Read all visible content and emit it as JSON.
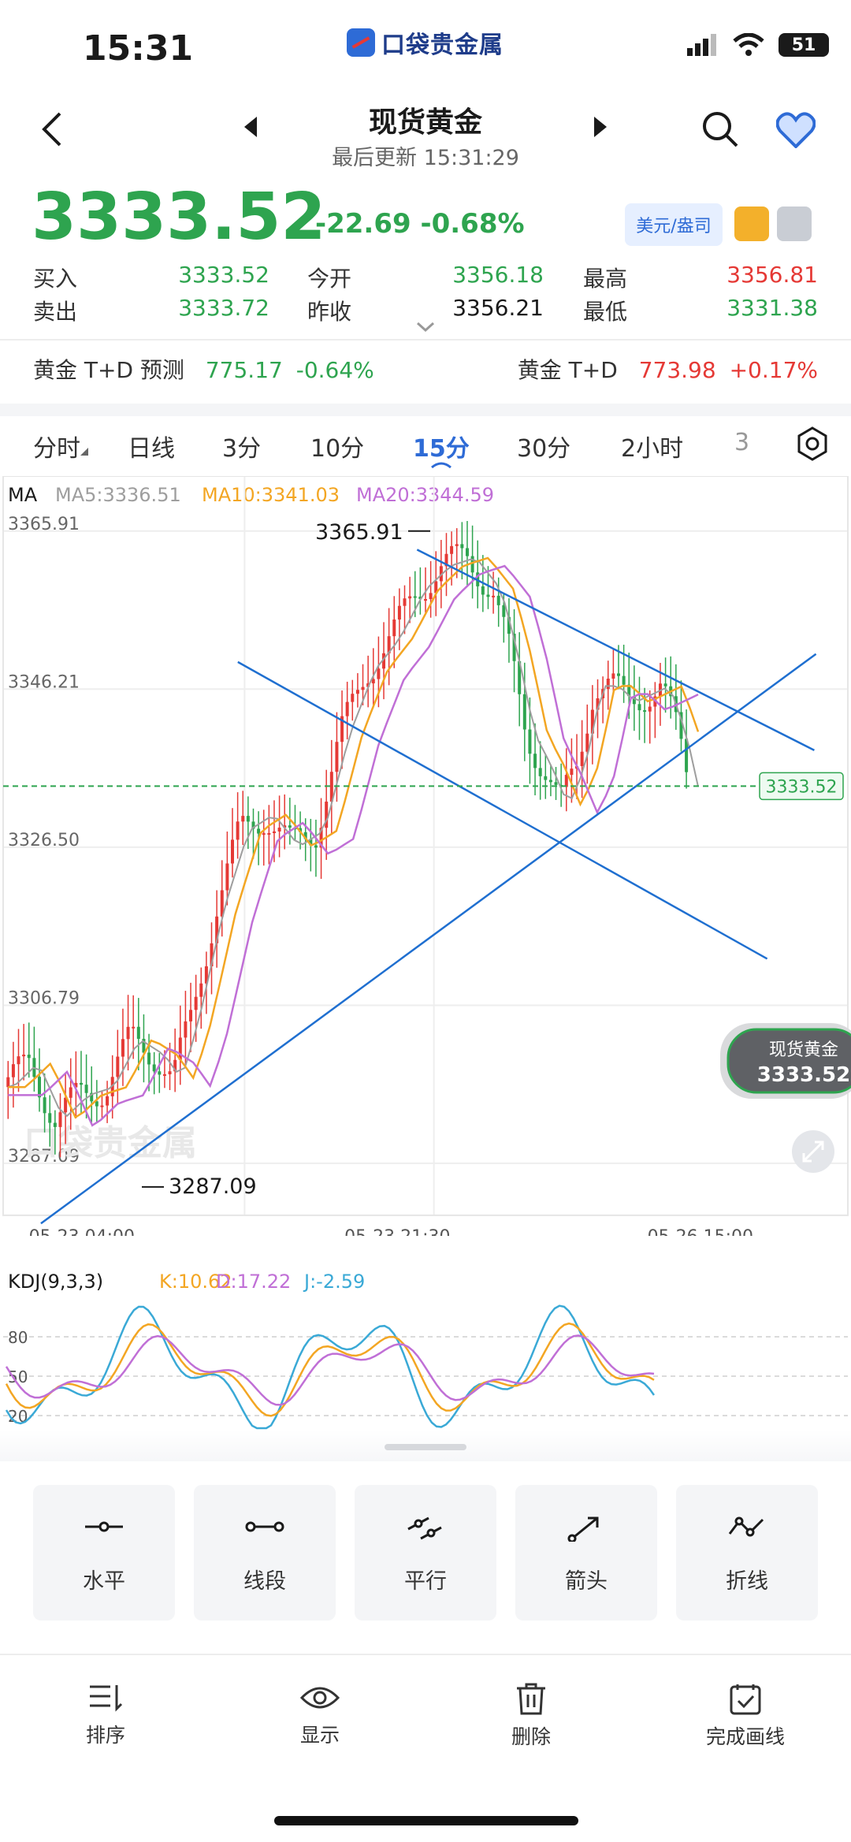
{
  "status": {
    "time": "15:31",
    "battery": "51"
  },
  "app": {
    "logo_text": "口袋贵金属"
  },
  "header": {
    "title": "现货黄金",
    "subtitle": "最后更新 15:31:29"
  },
  "quote": {
    "price": "3333.52",
    "change": "-22.69 -0.68%",
    "currency_button": "美元/盎司",
    "buy_label": "买入",
    "buy_value": "3333.52",
    "sell_label": "卖出",
    "sell_value": "3333.72",
    "open_label": "今开",
    "open_value": "3356.18",
    "prev_close_label": "昨收",
    "prev_close_value": "3356.21",
    "high_label": "最高",
    "high_value": "3356.81",
    "low_label": "最低",
    "low_value": "3331.38"
  },
  "td": {
    "forecast_label": "黄金 T+D 预测",
    "forecast_value": "775.17",
    "forecast_change": "-0.64%",
    "td_label": "黄金 T+D",
    "td_value": "773.98",
    "td_change": "+0.17%"
  },
  "tabs": [
    "分时",
    "日线",
    "3分",
    "10分",
    "15分",
    "30分",
    "2小时",
    "3"
  ],
  "active_tab": "15分",
  "ma": {
    "label": "MA",
    "ma5": "MA5:3336.51",
    "ma10": "MA10:3341.03",
    "ma20": "MA20:3344.59"
  },
  "chart_data": {
    "type": "candlestick",
    "interval": "15分",
    "y_ticks": [
      "3365.91",
      "3346.21",
      "3326.50",
      "3306.79",
      "3287.09"
    ],
    "x_ticks": [
      "05-23 04:00",
      "05-23 21:30",
      "05-26 15:00"
    ],
    "high_annotation": "3365.91",
    "low_annotation": "3287.09",
    "current_price_label": "3333.52",
    "ylim": [
      3281.0,
      3371.0
    ],
    "colors": {
      "up": "#e53935",
      "down": "#2ea44f",
      "ma5": "#9e9e9e",
      "ma10": "#f3a623",
      "ma20": "#c06fd6",
      "drawn_lines": "#1f6fd0"
    },
    "drawn_lines": [
      {
        "from": [
          0.043,
          3279.0
        ],
        "to": [
          0.964,
          3350.0
        ]
      },
      {
        "from": [
          0.277,
          3349.0
        ],
        "to": [
          0.906,
          3312.0
        ]
      },
      {
        "from": [
          0.49,
          3363.0
        ],
        "to": [
          0.962,
          3338.0
        ]
      }
    ]
  },
  "float_badge": {
    "name": "现货黄金",
    "value": "3333.52"
  },
  "kdj": {
    "label": "KDJ(9,3,3)",
    "k": "K:10.62",
    "d": "D:17.22",
    "j": "J:-2.59",
    "levels": [
      "80",
      "50",
      "20"
    ]
  },
  "tools": [
    {
      "icon": "horizontal-line-icon",
      "label": "水平"
    },
    {
      "icon": "segment-icon",
      "label": "线段"
    },
    {
      "icon": "parallel-icon",
      "label": "平行"
    },
    {
      "icon": "arrow-icon",
      "label": "箭头"
    },
    {
      "icon": "polyline-icon",
      "label": "折线"
    }
  ],
  "bottom": [
    {
      "icon": "sort-icon",
      "label": "排序"
    },
    {
      "icon": "eye-icon",
      "label": "显示"
    },
    {
      "icon": "trash-icon",
      "label": "删除"
    },
    {
      "icon": "finish-icon",
      "label": "完成画线"
    }
  ]
}
